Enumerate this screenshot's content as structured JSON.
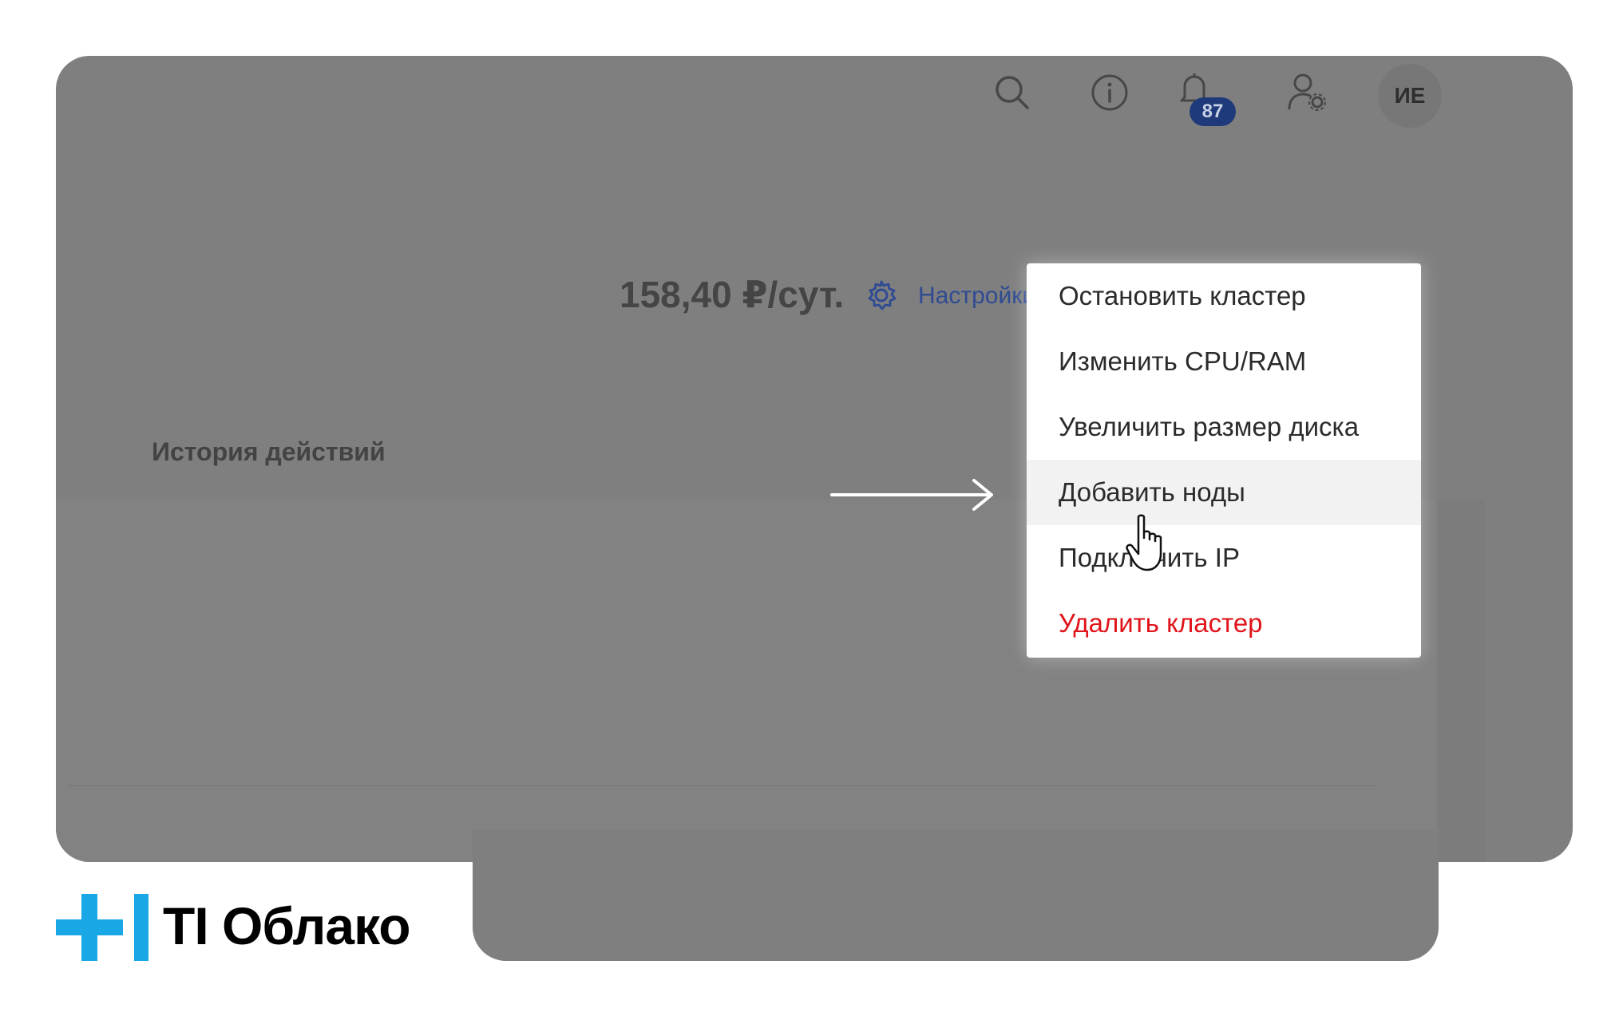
{
  "header": {
    "notifications_count": "87",
    "avatar_initials": "ИЕ",
    "icons": [
      "search-icon",
      "info-icon",
      "bell-icon",
      "user-settings-icon"
    ]
  },
  "main": {
    "price": "158,40 ₽/сут.",
    "settings_link": "Настройки",
    "history_title": "История действий"
  },
  "context_menu": {
    "items": [
      {
        "label": "Остановить кластер"
      },
      {
        "label": "Изменить CPU/RAM"
      },
      {
        "label": "Увеличить размер диска"
      },
      {
        "label": "Добавить ноды"
      },
      {
        "label": "Подключить IP"
      },
      {
        "label": "Удалить кластер"
      }
    ],
    "hovered_item": "Добавить ноды"
  },
  "branding": {
    "logo_text": "TI Облако",
    "accent_color": "#1aa7e6"
  },
  "colors": {
    "overlay": "#7f7f7f",
    "danger": "#e0141a",
    "link": "#2f4b93",
    "badge": "#1e3a7a"
  }
}
